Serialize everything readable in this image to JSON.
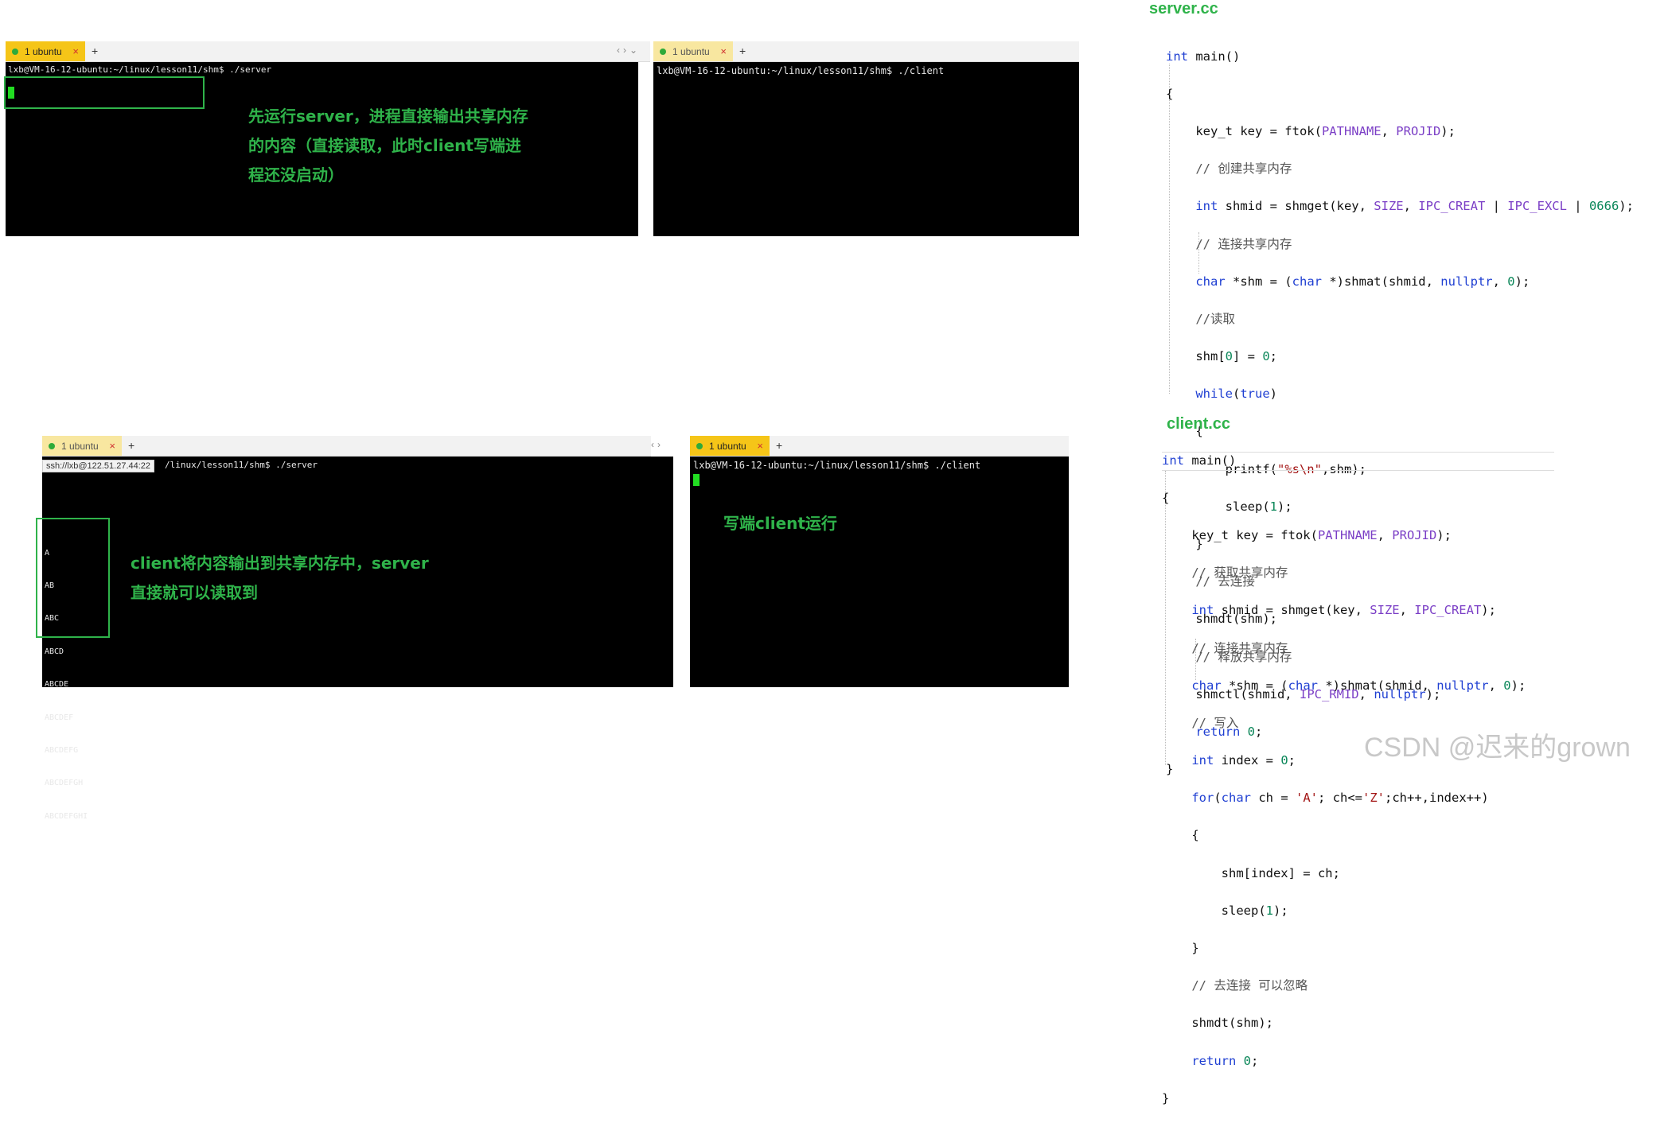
{
  "top_server_terminal": {
    "tab_label": "1 ubuntu",
    "prompt": "lxb@VM-16-12-ubuntu:~/linux/lesson11/shm$ ./server"
  },
  "top_client_terminal": {
    "tab_label": "1 ubuntu",
    "prompt": "lxb@VM-16-12-ubuntu:~/linux/lesson11/shm$ ./client"
  },
  "annotation_top": {
    "lines": [
      "先运行server，进程直接输出共享内存",
      "的内容（直接读取，此时client写端进",
      "程还没启动）"
    ]
  },
  "bottom_server_terminal": {
    "tab_label": "1 ubuntu",
    "ssh_tip": "ssh://lxb@122.51.27.44:22",
    "prompt_tail": "/linux/lesson11/shm$ ./server",
    "output": [
      "A",
      "AB",
      "ABC",
      "ABCD",
      "ABCDE",
      "ABCDEF",
      "ABCDEFG",
      "ABCDEFGH",
      "ABCDEFGHI"
    ]
  },
  "bottom_client_terminal": {
    "tab_label": "1 ubuntu",
    "prompt": "lxb@VM-16-12-ubuntu:~/linux/lesson11/shm$ ./client"
  },
  "annotation_bottom_left": {
    "lines": [
      "client将内容输出到共享内存中，server",
      "直接就可以读取到"
    ]
  },
  "annotation_bottom_right": {
    "text": "写端client运行"
  },
  "server_code": {
    "title": "server.cc",
    "lines": [
      "int main()",
      "{",
      "    key_t key = ftok(PATHNAME, PROJID);",
      "    // 创建共享内存",
      "    int shmid = shmget(key, SIZE, IPC_CREAT | IPC_EXCL | 0666);",
      "    // 连接共享内存",
      "    char *shm = (char *)shmat(shmid, nullptr, 0);",
      "    //读取",
      "    shm[0] = 0;",
      "    while(true)",
      "    {",
      "        printf(\"%s\\n\",shm);",
      "        sleep(1);",
      "    }",
      "    // 去连接",
      "    shmdt(shm);",
      "    // 释放共享内存",
      "    shmctl(shmid, IPC_RMID, nullptr);",
      "    return 0;",
      "}"
    ]
  },
  "client_code": {
    "title": "client.cc",
    "lines": [
      "int main()",
      "{",
      "    key_t key = ftok(PATHNAME, PROJID);",
      "    // 获取共享内存",
      "    int shmid = shmget(key, SIZE, IPC_CREAT);",
      "    // 连接共享内存",
      "    char *shm = (char *)shmat(shmid, nullptr, 0);",
      "    // 写入",
      "    int index = 0;",
      "    for(char ch = 'A'; ch<='Z';ch++,index++)",
      "    {",
      "        shm[index] = ch;",
      "        sleep(1);",
      "    }",
      "    // 去连接 可以忽略",
      "    shmdt(shm);",
      "    return 0;",
      "}"
    ]
  },
  "watermark": "CSDN @迟来的grown",
  "colors": {
    "accent_green": "#2fb34a",
    "tab_yellow": "#f5c518",
    "terminal_bg": "#000000"
  }
}
